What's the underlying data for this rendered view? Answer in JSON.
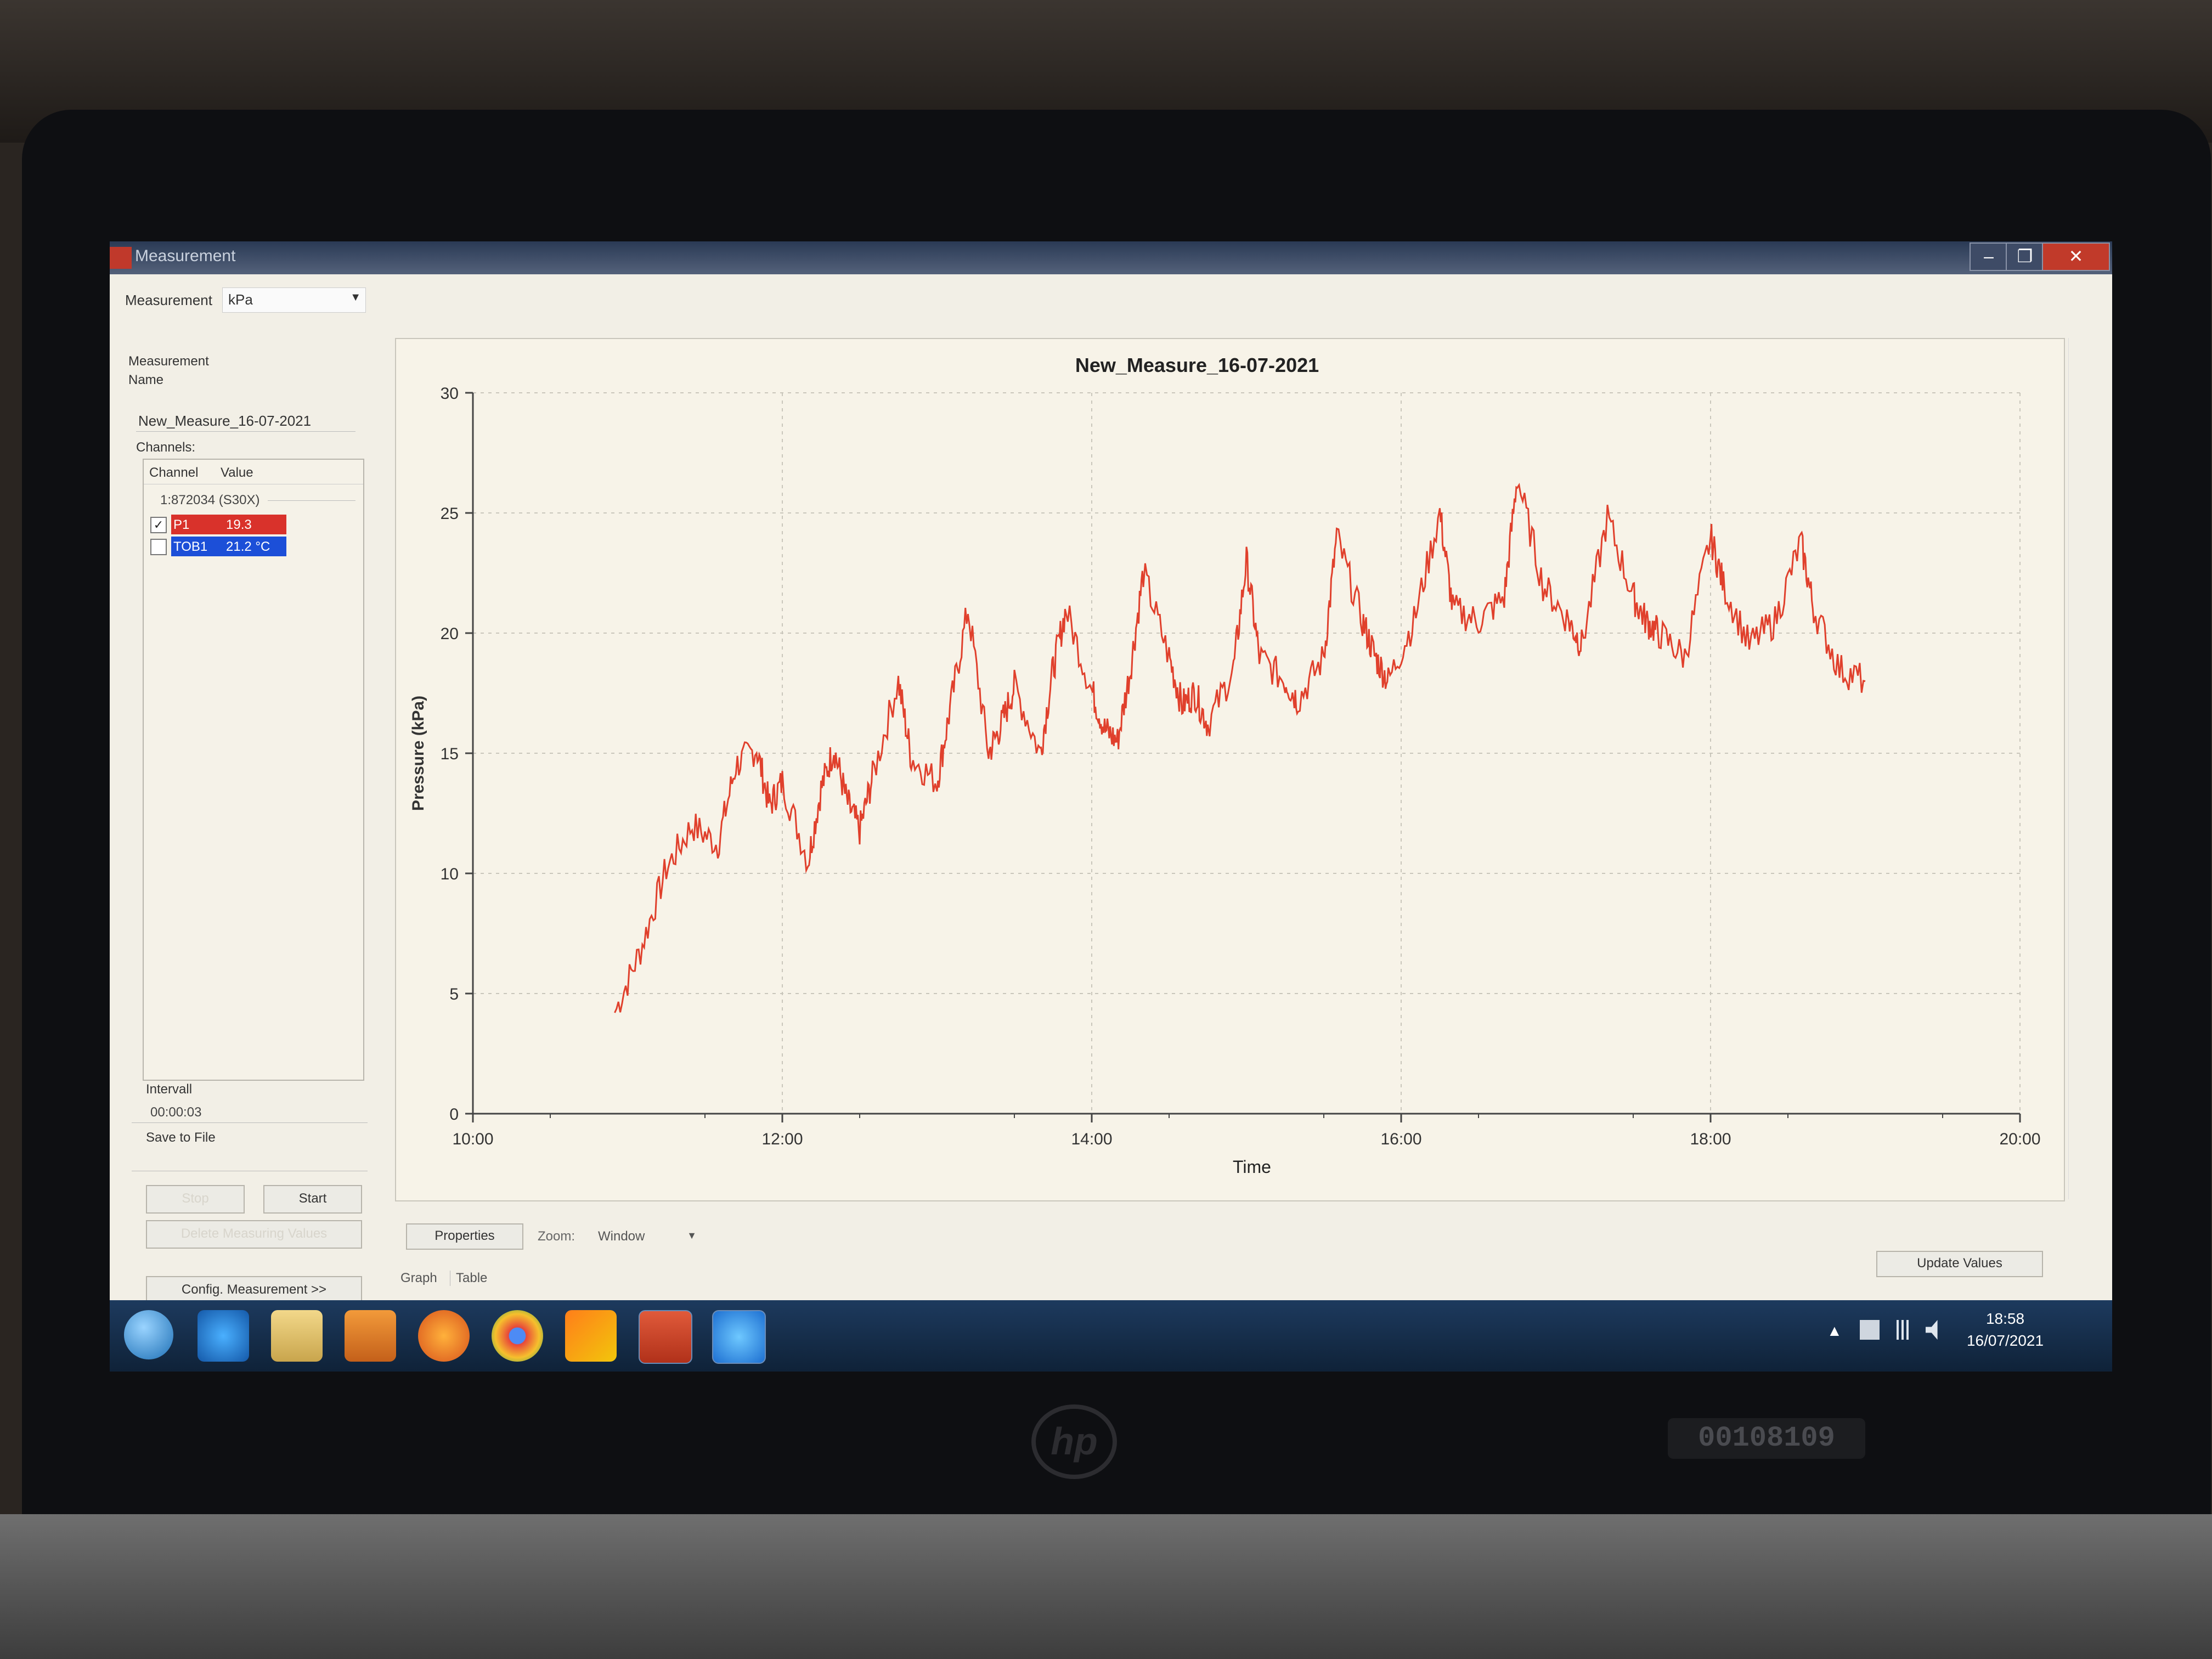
{
  "window": {
    "title": "Measurement"
  },
  "left_panel": {
    "measurement_label": "Measurement",
    "unit_value": "kPa",
    "name_label": "Measurement\nName",
    "name_value": "New_Measure_16-07-2021",
    "channels_label": "Channels:",
    "table_headers": [
      "Channel",
      "Value"
    ],
    "device": "1:872034 (S30X)",
    "channels": [
      {
        "name": "P1",
        "value": "19.3",
        "checked": true,
        "color": "#d9322b"
      },
      {
        "name": "TOB1",
        "value": "21.2 °C",
        "checked": false,
        "color": "#1c4fd8"
      }
    ],
    "interval_label": "Intervall",
    "interval_value": "00:00:03",
    "save_label": "Save to File",
    "stop_label": "Stop",
    "start_label": "Start",
    "delete_label": "Delete Measuring Values",
    "config_label": "Config. Measurement >>"
  },
  "bottom": {
    "properties_label": "Properties",
    "zoom_label": "Zoom:",
    "zoom_value": "Window",
    "tab_graph": "Graph",
    "tab_table": "Table",
    "update_label": "Update Values"
  },
  "taskbar": {
    "icons": [
      "start-orb",
      "ie-icon",
      "explorer-icon",
      "media-player-icon",
      "firefox-icon",
      "chrome-icon",
      "ccs-icon",
      "powerpoint-icon",
      "teamviewer-icon"
    ],
    "time": "18:58",
    "date": "16/07/2021"
  },
  "device": {
    "logo": "hp",
    "asset_tag": "00108109"
  },
  "chart_data": {
    "type": "line",
    "title": "New_Measure_16-07-2021",
    "xlabel": "Time",
    "ylabel": "Pressure (kPa)",
    "x_ticks": [
      "10:00",
      "12:00",
      "14:00",
      "16:00",
      "18:00",
      "20:00"
    ],
    "y_ticks": [
      "0",
      "5",
      "10",
      "15",
      "20",
      "25",
      "30"
    ],
    "xlim": [
      "10:00",
      "20:00"
    ],
    "ylim": [
      0,
      30
    ],
    "grid": true,
    "line_color": "#e0402c",
    "series": [
      {
        "name": "P1",
        "x": [
          "10:55",
          "11:05",
          "11:15",
          "11:25",
          "11:35",
          "11:42",
          "11:50",
          "11:55",
          "12:00",
          "12:10",
          "12:15",
          "12:20",
          "12:25",
          "12:30",
          "12:35",
          "12:45",
          "12:50",
          "13:00",
          "13:05",
          "13:12",
          "13:20",
          "13:25",
          "13:30",
          "13:40",
          "13:45",
          "13:50",
          "14:00",
          "14:05",
          "14:10",
          "14:15",
          "14:20",
          "14:30",
          "14:35",
          "14:40",
          "14:45",
          "14:55",
          "15:00",
          "15:05",
          "15:15",
          "15:20",
          "15:30",
          "15:35",
          "15:45",
          "15:50",
          "15:55",
          "16:05",
          "16:15",
          "16:20",
          "16:30",
          "16:40",
          "16:45",
          "16:55",
          "17:05",
          "17:10",
          "17:20",
          "17:30",
          "17:35",
          "17:40",
          "17:50",
          "18:00",
          "18:05",
          "18:15",
          "18:25",
          "18:35",
          "18:40",
          "18:50",
          "19:00"
        ],
        "y": [
          4.2,
          6.8,
          10.2,
          12.0,
          11.2,
          14.5,
          15.2,
          12.8,
          13.8,
          10.5,
          13.5,
          15.2,
          13.0,
          11.8,
          14.0,
          18.0,
          14.8,
          13.8,
          16.8,
          21.0,
          15.0,
          16.2,
          17.8,
          15.0,
          18.5,
          21.0,
          17.6,
          16.0,
          15.5,
          18.5,
          22.5,
          19.0,
          17.0,
          17.5,
          16.2,
          18.5,
          23.0,
          19.0,
          18.0,
          17.2,
          19.0,
          24.0,
          20.5,
          19.0,
          18.0,
          20.5,
          25.0,
          21.0,
          20.5,
          21.5,
          26.5,
          22.0,
          20.5,
          19.5,
          24.8,
          21.5,
          20.5,
          20.0,
          19.0,
          24.0,
          22.0,
          19.5,
          20.5,
          23.8,
          21.0,
          18.5,
          18.0
        ]
      }
    ]
  }
}
